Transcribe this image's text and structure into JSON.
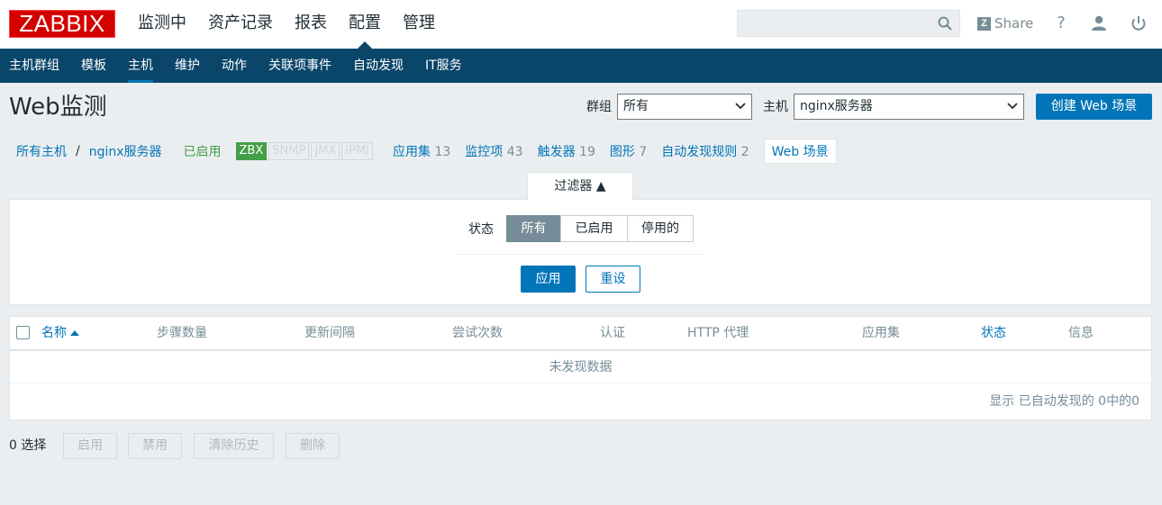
{
  "brand": {
    "logo_text": "ZABBIX",
    "accent": "#0275b8",
    "nav_bg": "#0a466a",
    "logo_bg": "#d40000"
  },
  "top_menu": [
    {
      "label": "监测中",
      "active": false
    },
    {
      "label": "资产记录",
      "active": false
    },
    {
      "label": "报表",
      "active": false
    },
    {
      "label": "配置",
      "active": true
    },
    {
      "label": "管理",
      "active": false
    }
  ],
  "header_tools": {
    "search_value": "",
    "search_icon": "search-icon",
    "share_label": "Share",
    "help_icon": "?",
    "user_icon": "user-icon",
    "power_icon": "power-icon"
  },
  "sub_menu": [
    {
      "label": "主机群组",
      "active": false
    },
    {
      "label": "模板",
      "active": false
    },
    {
      "label": "主机",
      "active": true
    },
    {
      "label": "维护",
      "active": false
    },
    {
      "label": "动作",
      "active": false
    },
    {
      "label": "关联项事件",
      "active": false
    },
    {
      "label": "自动发现",
      "active": false
    },
    {
      "label": "IT服务",
      "active": false
    }
  ],
  "page": {
    "title": "Web监测",
    "group_label": "群组",
    "group_value": "所有",
    "host_label": "主机",
    "host_value": "nginx服务器",
    "create_button": "创建 Web 场景"
  },
  "breadcrumb": {
    "all_hosts": "所有主机",
    "separator": "/",
    "host": "nginx服务器",
    "status": "已启用",
    "tags": [
      {
        "label": "ZBX",
        "active": true
      },
      {
        "label": "SNMP",
        "active": false
      },
      {
        "label": "JMX",
        "active": false
      },
      {
        "label": "IPMI",
        "active": false
      }
    ],
    "links": [
      {
        "label": "应用集",
        "count": "13"
      },
      {
        "label": "监控项",
        "count": "43"
      },
      {
        "label": "触发器",
        "count": "19"
      },
      {
        "label": "图形",
        "count": "7"
      },
      {
        "label": "自动发现规则",
        "count": "2"
      }
    ],
    "current": "Web 场景"
  },
  "filter": {
    "tab_label": "过滤器 ▲",
    "state_label": "状态",
    "state_options": [
      {
        "label": "所有",
        "selected": true
      },
      {
        "label": "已启用",
        "selected": false
      },
      {
        "label": "停用的",
        "selected": false
      }
    ],
    "apply_label": "应用",
    "reset_label": "重设"
  },
  "table": {
    "columns": [
      "名称",
      "步骤数量",
      "更新间隔",
      "尝试次数",
      "认证",
      "HTTP 代理",
      "应用集",
      "状态",
      "信息"
    ],
    "empty_text": "未发现数据",
    "paging_text": "显示 已自动发现的 0中的0"
  },
  "actions": {
    "selected_text": "0 选择",
    "buttons": [
      "启用",
      "禁用",
      "清除历史",
      "删除"
    ]
  }
}
